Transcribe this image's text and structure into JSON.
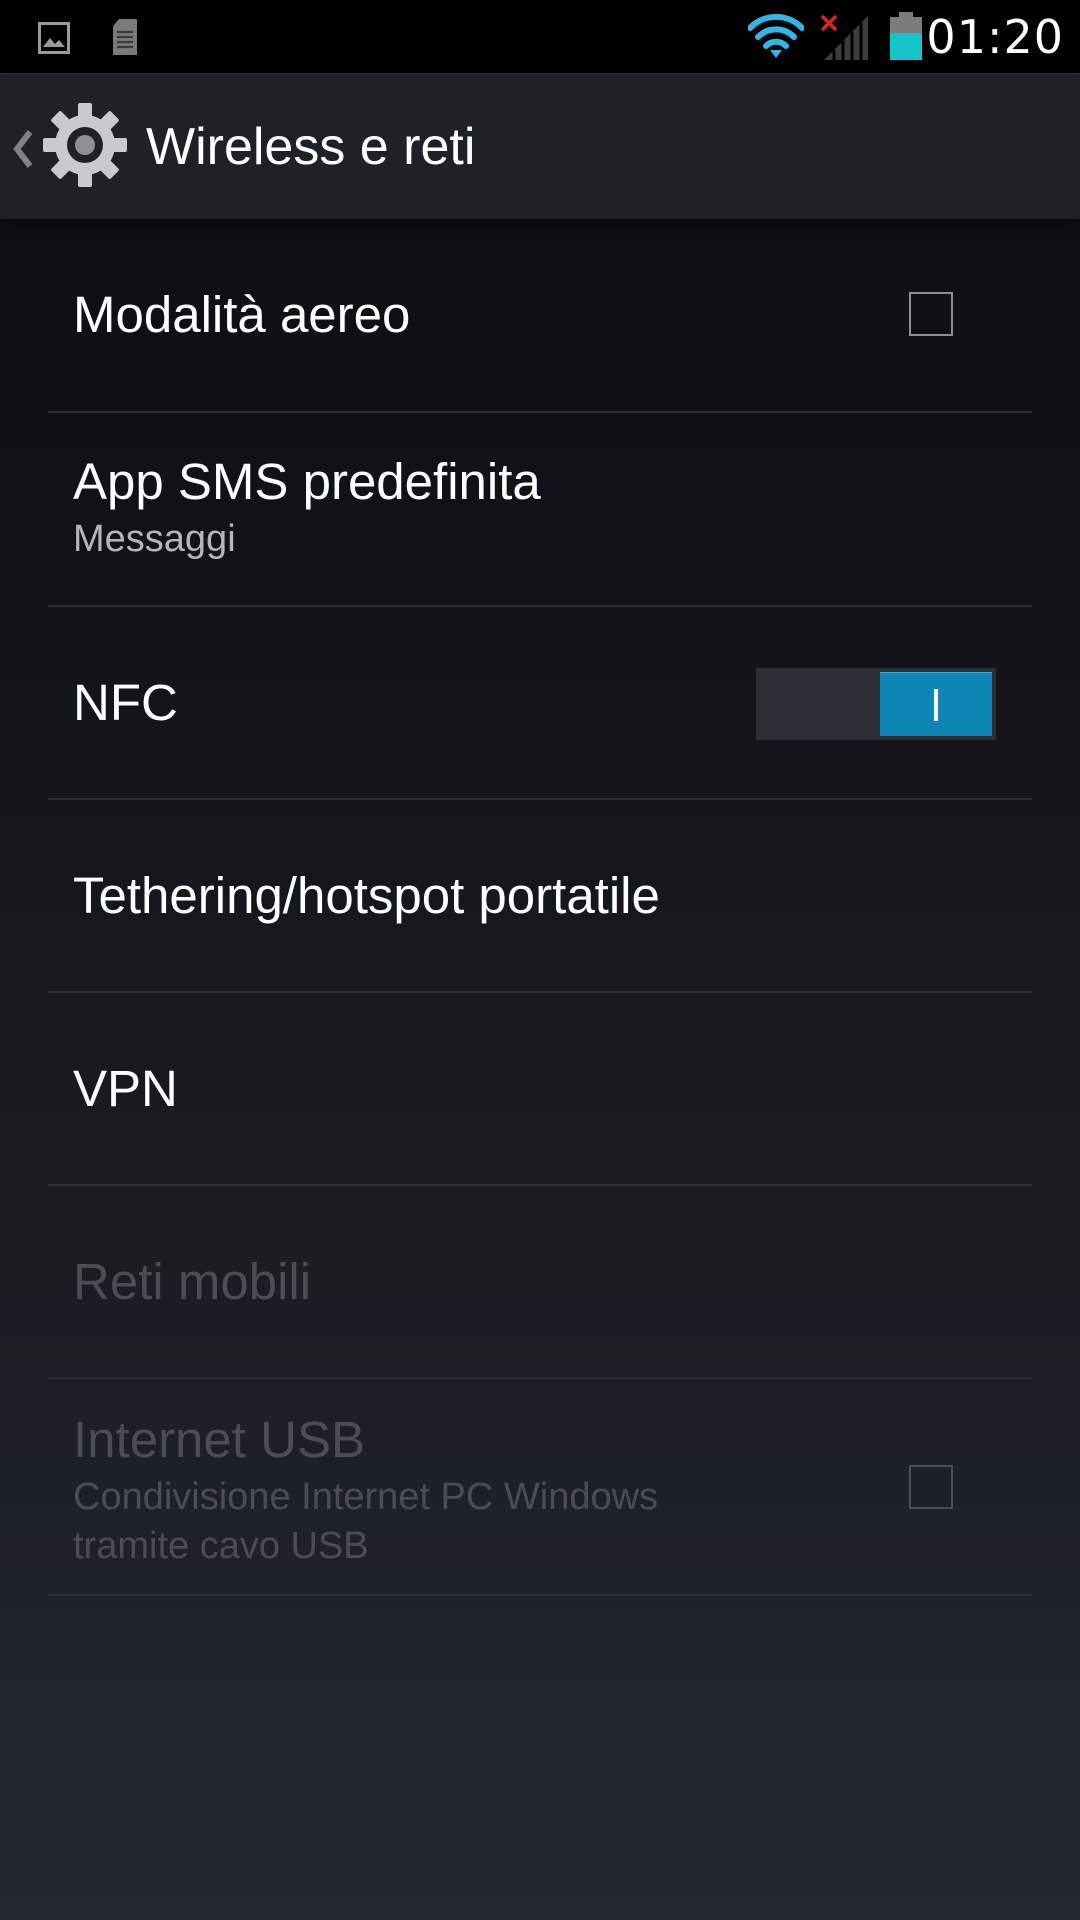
{
  "status_bar": {
    "time": "01:20",
    "notification_icons": [
      "picture-icon",
      "sd-card-icon"
    ],
    "system_icons": [
      "wifi-icon",
      "no-sim-icon",
      "signal-icon",
      "battery-icon"
    ],
    "accent_color": "#33b5e5",
    "battery_fill_color": "#16c3c9",
    "no_sim_color": "#d0262b"
  },
  "action_bar": {
    "title": "Wireless e reti",
    "icon": "settings-gear-icon",
    "up_indicator": "chevron-left-icon"
  },
  "preferences": [
    {
      "title": "Modalità aereo",
      "widget": "checkbox",
      "checked": false,
      "enabled": true
    },
    {
      "title": "App SMS predefinita",
      "summary": "Messaggi",
      "enabled": true
    },
    {
      "title": "NFC",
      "widget": "switch",
      "on": true,
      "enabled": true
    },
    {
      "title": "Tethering/hotspot portatile",
      "enabled": true
    },
    {
      "title": "VPN",
      "enabled": true
    },
    {
      "title": "Reti mobili",
      "enabled": false
    },
    {
      "title": "Internet USB",
      "summary_lines": [
        "Condivisione Internet PC Windows",
        "tramite cavo USB"
      ],
      "widget": "checkbox",
      "checked": false,
      "enabled": false
    }
  ],
  "colors": {
    "switch_on": "#0d86b5",
    "disabled_text": "#4a4e54",
    "divider": "#2b2f35"
  }
}
